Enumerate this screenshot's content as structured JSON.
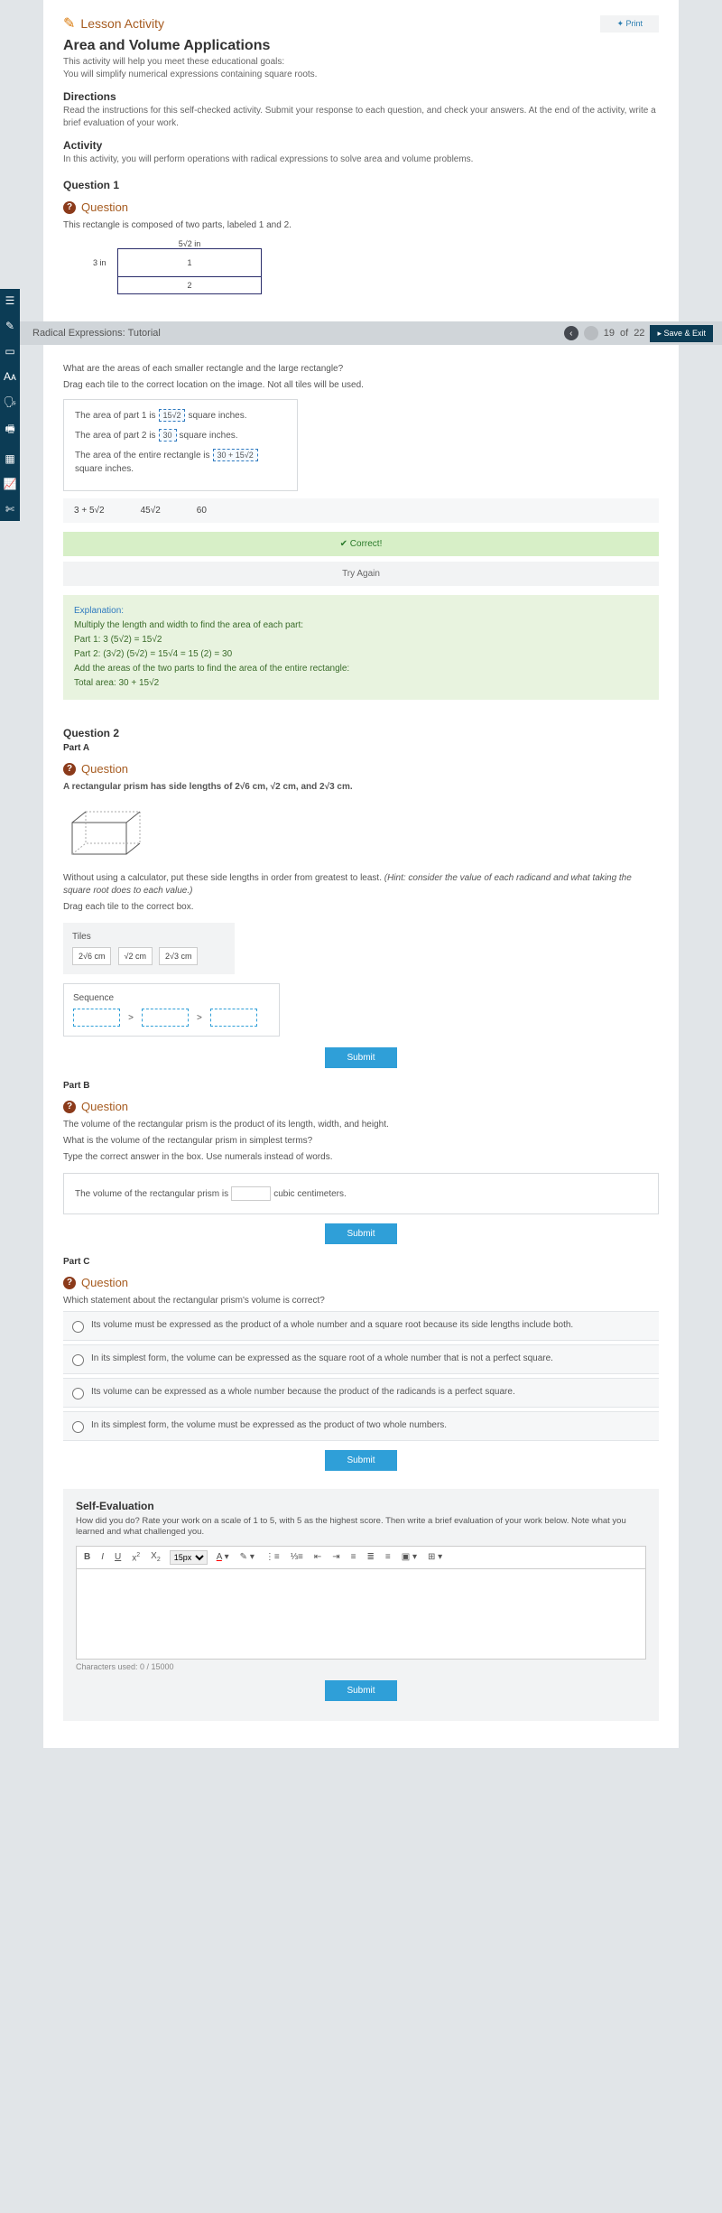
{
  "header": {
    "lesson_label": "Lesson Activity",
    "print_label": "Print",
    "title": "Area and Volume Applications",
    "goals_intro": "This activity will help you meet these educational goals:",
    "goals_detail": "You will simplify numerical expressions containing square roots.",
    "directions_h": "Directions",
    "directions_body": "Read the instructions for this self-checked activity. Submit your response to each question, and check your answers. At the end of the activity, write a brief evaluation of your work.",
    "activity_h": "Activity",
    "activity_body": "In this activity, you will perform operations with radical expressions to solve area and volume problems."
  },
  "topstrip": {
    "title": "Radical Expressions: Tutorial",
    "page_current": "19",
    "page_of": "of",
    "page_total": "22",
    "save_exit": "Save & Exit"
  },
  "q1": {
    "number": "Question 1",
    "qlabel": "Question",
    "intro": "This rectangle is composed of two parts, labeled 1 and 2.",
    "dim_top": "5√2 in",
    "dim_side": "3 in",
    "part1_label": "1",
    "part2_label": "2",
    "prompt1": "What are the areas of each smaller rectangle and the large rectangle?",
    "prompt2": "Drag each tile to the correct location on the image. Not all tiles will be used.",
    "row1_a": "The area of part 1 is",
    "row1_chip": "15√2",
    "row1_b": "square inches.",
    "row2_a": "The area of part 2 is",
    "row2_chip": "30",
    "row2_b": "square inches.",
    "row3_a": "The area of the entire rectangle is",
    "row3_chip": "30 + 15√2",
    "row3_b": "square inches.",
    "tileA": "3 + 5√2",
    "tileB": "45√2",
    "tileC": "60",
    "correct": "Correct!",
    "tryagain": "Try Again",
    "exp_h": "Explanation:",
    "exp_l1": "Multiply the length and width to find the area of each part:",
    "exp_l2": "Part 1: 3 (5√2) = 15√2",
    "exp_l3": "Part 2: (3√2) (5√2) = 15√4 = 15 (2) = 30",
    "exp_l4": "Add the areas of the two parts to find the area of the entire rectangle:",
    "exp_l5": "Total area: 30 + 15√2"
  },
  "q2": {
    "number": "Question 2",
    "partA": "Part A",
    "qlabel": "Question",
    "intro": "A rectangular prism has side lengths of 2√6 cm, √2 cm, and 2√3 cm.",
    "body1": "Without using a calculator, put these side lengths in order from greatest to least. (Hint: consider the value of each radicand and what taking the square root does to each value.)",
    "body2": "Drag each tile to the correct box.",
    "tiles_h": "Tiles",
    "tile1": "2√6 cm",
    "tile2": "√2 cm",
    "tile3": "2√3 cm",
    "seq_h": "Sequence",
    "submit": "Submit",
    "partB": "Part B",
    "b_l1": "The volume of the rectangular prism is the product of its length, width, and height.",
    "b_l2": "What is the volume of the rectangular prism in simplest terms?",
    "b_l3": "Type the correct answer in the box. Use numerals instead of words.",
    "b_sentence_a": "The volume of the rectangular prism is",
    "b_sentence_b": "cubic centimeters.",
    "partC": "Part C",
    "c_prompt": "Which statement about the rectangular prism's volume is correct?",
    "c_opt1": "Its volume must be expressed as the product of a whole number and a square root because its side lengths include both.",
    "c_opt2": "In its simplest form, the volume can be expressed as the square root of a whole number that is not a perfect square.",
    "c_opt3": "Its volume can be expressed as a whole number because the product of the radicands is a perfect square.",
    "c_opt4": "In its simplest form, the volume must be expressed as the product of two whole numbers."
  },
  "selfeval": {
    "h": "Self-Evaluation",
    "p": "How did you do? Rate your work on a scale of 1 to 5, with 5 as the highest score. Then write a brief evaluation of your work below. Note what you learned and what challenged you.",
    "fontsize": "15px",
    "charcount": "Characters used: 0 / 15000",
    "submit": "Submit"
  }
}
